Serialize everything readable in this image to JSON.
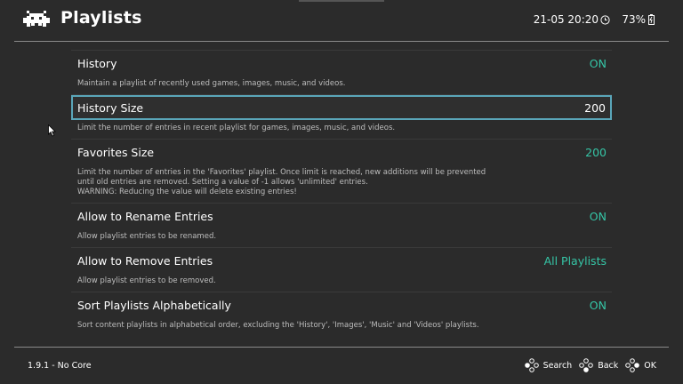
{
  "header": {
    "title": "Playlists",
    "clock": "21-05 20:20",
    "battery": "73%"
  },
  "items": [
    {
      "label": "History",
      "value": "ON",
      "desc": "Maintain a playlist of recently used games, images, music, and videos."
    },
    {
      "label": "History Size",
      "value": "200",
      "desc": "Limit the number of entries in recent playlist for games, images, music, and videos."
    },
    {
      "label": "Favorites Size",
      "value": "200",
      "desc": "Limit the number of entries in the 'Favorites' playlist. Once limit is reached, new additions will be prevented\nuntil old entries are removed. Setting a value of -1 allows 'unlimited' entries.\nWARNING: Reducing the value will delete existing entries!"
    },
    {
      "label": "Allow to Rename Entries",
      "value": "ON",
      "desc": "Allow playlist entries to be renamed."
    },
    {
      "label": "Allow to Remove Entries",
      "value": "All Playlists",
      "desc": "Allow playlist entries to be removed."
    },
    {
      "label": "Sort Playlists Alphabetically",
      "value": "ON",
      "desc": "Sort content playlists in alphabetical order, excluding the 'History', 'Images', 'Music' and 'Videos' playlists."
    }
  ],
  "footer": {
    "version": "1.9.1 - No Core",
    "search_label": "Search",
    "back_label": "Back",
    "ok_label": "OK"
  },
  "colors": {
    "background": "#2b2b2b",
    "accent_value": "#35c5a6",
    "selection_border": "#5aa6b9"
  },
  "icons": {
    "logo": "retroarch-invader-icon",
    "clock": "clock-icon",
    "battery": "battery-icon",
    "controller": "gamepad-buttons-icon"
  }
}
